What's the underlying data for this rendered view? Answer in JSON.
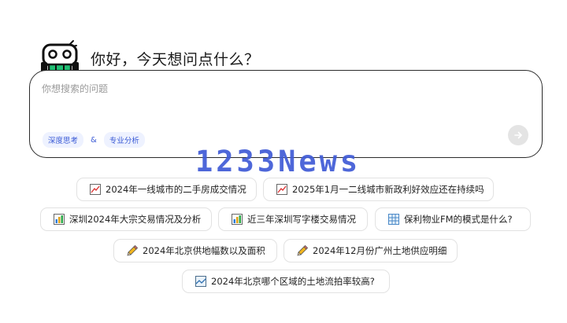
{
  "greeting": "你好，今天想问点什么？",
  "search": {
    "placeholder": "你想搜索的问题",
    "value": ""
  },
  "modes": {
    "deep_thinking": "深度思考",
    "separator": "&",
    "professional": "专业分析"
  },
  "watermark": "1233News",
  "colors": {
    "accent": "#3b5bd6",
    "watermark": "#3f5bd6",
    "border": "#2b2b2b",
    "send_bg": "#e4e4e4"
  },
  "suggestions": [
    {
      "label": "2024年一线城市的二手房成交情况",
      "icon": "trend-chart-icon"
    },
    {
      "label": "2025年1月一二线城市新政利好效应还在持续吗",
      "icon": "trend-chart-icon"
    },
    {
      "label": "深圳2024年大宗交易情况及分析",
      "icon": "bar-chart-icon"
    },
    {
      "label": "近三年深圳写字楼交易情况",
      "icon": "bar-chart-icon"
    },
    {
      "label": "保利物业FM的模式是什么?",
      "icon": "grid-table-icon"
    },
    {
      "label": "2024年北京供地幅数以及面积",
      "icon": "pencil-icon"
    },
    {
      "label": "2024年12月份广州土地供应明细",
      "icon": "pencil-icon"
    },
    {
      "label": "2024年北京哪个区域的土地流拍率较高?",
      "icon": "image-chart-icon"
    }
  ]
}
